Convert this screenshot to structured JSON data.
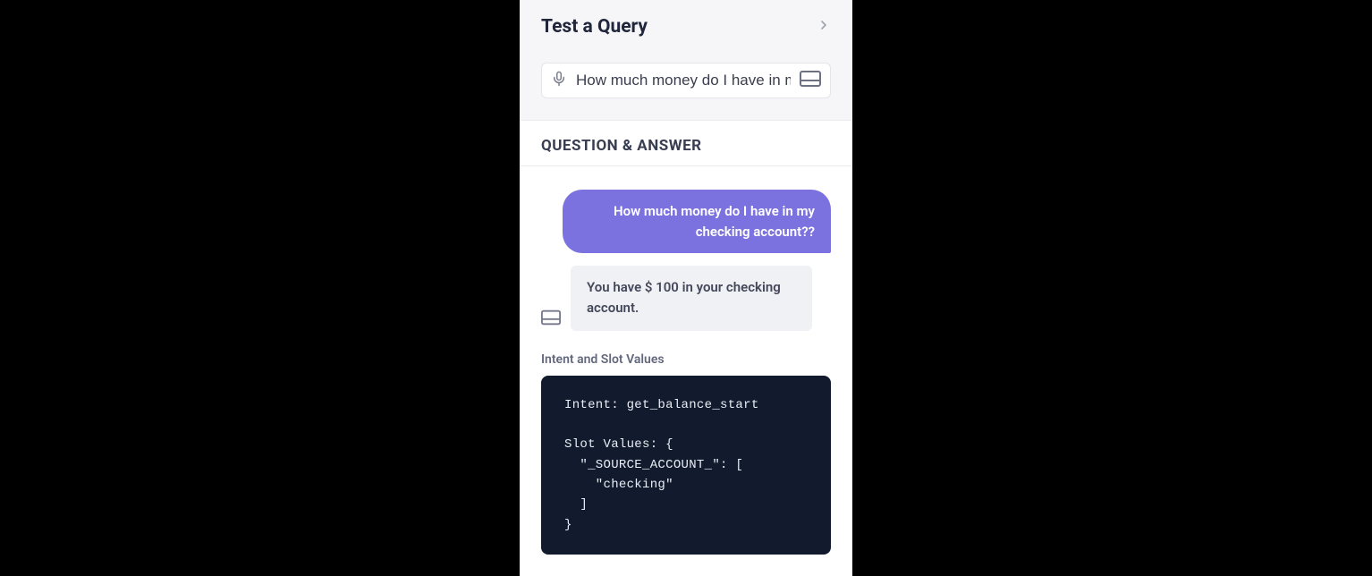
{
  "header": {
    "title": "Test a Query"
  },
  "query": {
    "value": "How much money do I have in my"
  },
  "qa": {
    "heading": "QUESTION & ANSWER",
    "user_message": "How much money do I have in my checking account??",
    "bot_message": "You have $ 100 in your checking account."
  },
  "intent": {
    "label": "Intent and Slot Values",
    "code": "Intent: get_balance_start\n\nSlot Values: {\n  \"_SOURCE_ACCOUNT_\": [\n    \"checking\"\n  ]\n}"
  },
  "colors": {
    "accent_purple": "#7b72df",
    "code_bg": "#121a2e",
    "text_dark": "#20263c"
  }
}
